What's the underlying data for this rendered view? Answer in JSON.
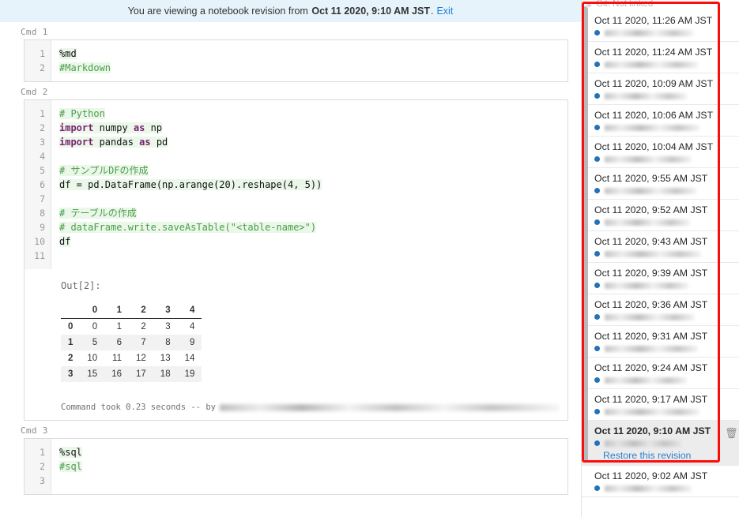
{
  "banner": {
    "prefix": "You are viewing a notebook revision from",
    "timestamp": "Oct 11 2020, 9:10 AM JST",
    "suffix": ".",
    "exit_label": "Exit"
  },
  "notebook": {
    "cells": [
      {
        "label": "Cmd 1",
        "line_numbers": [
          "1",
          "2"
        ],
        "code": [
          "%md",
          "#Markdown"
        ]
      },
      {
        "label": "Cmd 2",
        "line_numbers": [
          "1",
          "2",
          "3",
          "4",
          "5",
          "6",
          "7",
          "8",
          "9",
          "10",
          "11"
        ],
        "code": [
          "# Python",
          "import numpy as np",
          "import pandas as pd",
          "",
          "# サンプルDFの作成",
          "df = pd.DataFrame(np.arange(20).reshape(4, 5))",
          "",
          "# テーブルの作成",
          "# dataFrame.write.saveAsTable(\"<table-name>\")",
          "df",
          ""
        ],
        "output_label": "Out[2]:",
        "table": {
          "columns": [
            "",
            "0",
            "1",
            "2",
            "3",
            "4"
          ],
          "rows": [
            [
              "0",
              "0",
              "1",
              "2",
              "3",
              "4"
            ],
            [
              "1",
              "5",
              "6",
              "7",
              "8",
              "9"
            ],
            [
              "2",
              "10",
              "11",
              "12",
              "13",
              "14"
            ],
            [
              "3",
              "15",
              "16",
              "17",
              "18",
              "19"
            ]
          ]
        },
        "status": "Command took 0.23 seconds -- by",
        "status_author_redacted": "redacted-author-email"
      },
      {
        "label": "Cmd 3",
        "line_numbers": [
          "1",
          "2",
          "3"
        ],
        "code": [
          "%sql",
          "#sql",
          ""
        ]
      }
    ]
  },
  "sidebar": {
    "git_status": "Git: Not linked",
    "git_icon": "git-branch-icon",
    "restore_label": "Restore this revision",
    "delete_icon": "trash-icon",
    "revisions": [
      {
        "time": "Oct 11 2020, 11:26 AM JST",
        "author_redacted": "redacted-author",
        "selected": false
      },
      {
        "time": "Oct 11 2020, 11:24 AM JST",
        "author_redacted": "redacted-author",
        "selected": false
      },
      {
        "time": "Oct 11 2020, 10:09 AM JST",
        "author_redacted": "redacted-author",
        "selected": false
      },
      {
        "time": "Oct 11 2020, 10:06 AM JST",
        "author_redacted": "redacted-author",
        "selected": false
      },
      {
        "time": "Oct 11 2020, 10:04 AM JST",
        "author_redacted": "redacted-author",
        "selected": false
      },
      {
        "time": "Oct 11 2020, 9:55 AM JST",
        "author_redacted": "redacted-author",
        "selected": false
      },
      {
        "time": "Oct 11 2020, 9:52 AM JST",
        "author_redacted": "redacted-author",
        "selected": false
      },
      {
        "time": "Oct 11 2020, 9:43 AM JST",
        "author_redacted": "redacted-author",
        "selected": false
      },
      {
        "time": "Oct 11 2020, 9:39 AM JST",
        "author_redacted": "redacted-author",
        "selected": false
      },
      {
        "time": "Oct 11 2020, 9:36 AM JST",
        "author_redacted": "redacted-author",
        "selected": false
      },
      {
        "time": "Oct 11 2020, 9:31 AM JST",
        "author_redacted": "redacted-author",
        "selected": false
      },
      {
        "time": "Oct 11 2020, 9:24 AM JST",
        "author_redacted": "redacted-author",
        "selected": false
      },
      {
        "time": "Oct 11 2020, 9:17 AM JST",
        "author_redacted": "redacted-author",
        "selected": false
      },
      {
        "time": "Oct 11 2020, 9:10 AM JST",
        "author_redacted": "redacted-author",
        "selected": true
      },
      {
        "time": "Oct 11 2020, 9:02 AM JST",
        "author_redacted": "redacted-author",
        "selected": false
      }
    ]
  },
  "colors": {
    "banner_bg": "#e7f3fb",
    "link": "#1b7fd4",
    "dot": "#2272b9",
    "annotation": "#fc0d0d",
    "selected_row": "#ececec",
    "code_highlight": "#eaf7e9",
    "comment": "#4a9e4a",
    "keyword": "#7b1f6e"
  }
}
